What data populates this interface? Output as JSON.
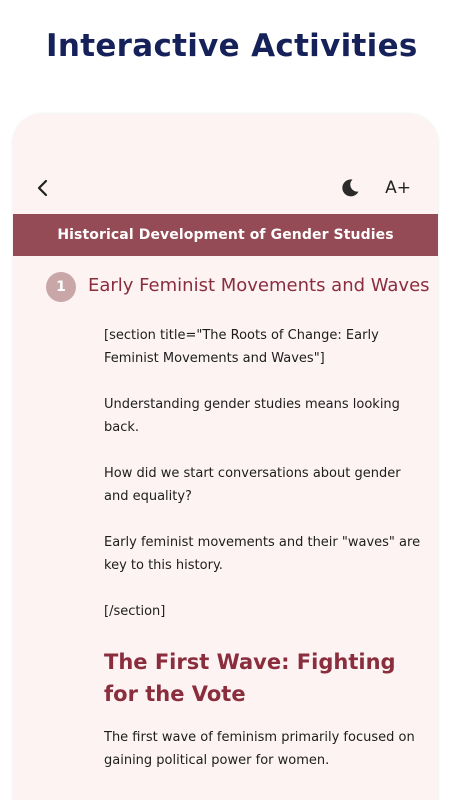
{
  "promo": {
    "title": "Interactive Activities"
  },
  "toolbar": {
    "back_icon": "chevron-left-icon",
    "theme_icon": "moon-icon",
    "font_size_label": "A+"
  },
  "banner": {
    "title": "Historical Development of Gender Studies"
  },
  "section": {
    "number": "1",
    "title": "Early Feminist Movements and Waves"
  },
  "content": {
    "paragraphs": [
      "[section title=\"The Roots of Change: Early Feminist Movements and Waves\"]",
      "Understanding gender studies means looking back.",
      "How did we start conversations about gender and equality?",
      "Early feminist movements and their \"waves\" are key to this history.",
      "[/section]"
    ],
    "subheading": "The First Wave: Fighting for the Vote",
    "after_paragraph": "The first wave of feminism primarily focused on gaining political power for women."
  },
  "colors": {
    "banner": "#954b55",
    "accent": "#8a2d3c",
    "background": "#fdf3f3",
    "promo_title": "#16215a"
  }
}
